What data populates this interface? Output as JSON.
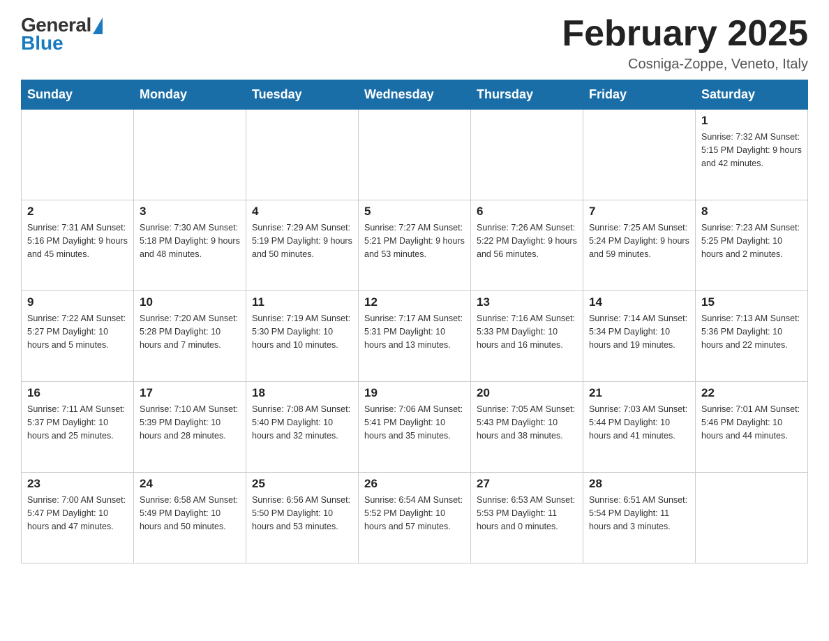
{
  "logo": {
    "general": "General",
    "blue": "Blue"
  },
  "title": "February 2025",
  "subtitle": "Cosniga-Zoppe, Veneto, Italy",
  "days_of_week": [
    "Sunday",
    "Monday",
    "Tuesday",
    "Wednesday",
    "Thursday",
    "Friday",
    "Saturday"
  ],
  "weeks": [
    [
      {
        "day": "",
        "info": ""
      },
      {
        "day": "",
        "info": ""
      },
      {
        "day": "",
        "info": ""
      },
      {
        "day": "",
        "info": ""
      },
      {
        "day": "",
        "info": ""
      },
      {
        "day": "",
        "info": ""
      },
      {
        "day": "1",
        "info": "Sunrise: 7:32 AM\nSunset: 5:15 PM\nDaylight: 9 hours\nand 42 minutes."
      }
    ],
    [
      {
        "day": "2",
        "info": "Sunrise: 7:31 AM\nSunset: 5:16 PM\nDaylight: 9 hours\nand 45 minutes."
      },
      {
        "day": "3",
        "info": "Sunrise: 7:30 AM\nSunset: 5:18 PM\nDaylight: 9 hours\nand 48 minutes."
      },
      {
        "day": "4",
        "info": "Sunrise: 7:29 AM\nSunset: 5:19 PM\nDaylight: 9 hours\nand 50 minutes."
      },
      {
        "day": "5",
        "info": "Sunrise: 7:27 AM\nSunset: 5:21 PM\nDaylight: 9 hours\nand 53 minutes."
      },
      {
        "day": "6",
        "info": "Sunrise: 7:26 AM\nSunset: 5:22 PM\nDaylight: 9 hours\nand 56 minutes."
      },
      {
        "day": "7",
        "info": "Sunrise: 7:25 AM\nSunset: 5:24 PM\nDaylight: 9 hours\nand 59 minutes."
      },
      {
        "day": "8",
        "info": "Sunrise: 7:23 AM\nSunset: 5:25 PM\nDaylight: 10 hours\nand 2 minutes."
      }
    ],
    [
      {
        "day": "9",
        "info": "Sunrise: 7:22 AM\nSunset: 5:27 PM\nDaylight: 10 hours\nand 5 minutes."
      },
      {
        "day": "10",
        "info": "Sunrise: 7:20 AM\nSunset: 5:28 PM\nDaylight: 10 hours\nand 7 minutes."
      },
      {
        "day": "11",
        "info": "Sunrise: 7:19 AM\nSunset: 5:30 PM\nDaylight: 10 hours\nand 10 minutes."
      },
      {
        "day": "12",
        "info": "Sunrise: 7:17 AM\nSunset: 5:31 PM\nDaylight: 10 hours\nand 13 minutes."
      },
      {
        "day": "13",
        "info": "Sunrise: 7:16 AM\nSunset: 5:33 PM\nDaylight: 10 hours\nand 16 minutes."
      },
      {
        "day": "14",
        "info": "Sunrise: 7:14 AM\nSunset: 5:34 PM\nDaylight: 10 hours\nand 19 minutes."
      },
      {
        "day": "15",
        "info": "Sunrise: 7:13 AM\nSunset: 5:36 PM\nDaylight: 10 hours\nand 22 minutes."
      }
    ],
    [
      {
        "day": "16",
        "info": "Sunrise: 7:11 AM\nSunset: 5:37 PM\nDaylight: 10 hours\nand 25 minutes."
      },
      {
        "day": "17",
        "info": "Sunrise: 7:10 AM\nSunset: 5:39 PM\nDaylight: 10 hours\nand 28 minutes."
      },
      {
        "day": "18",
        "info": "Sunrise: 7:08 AM\nSunset: 5:40 PM\nDaylight: 10 hours\nand 32 minutes."
      },
      {
        "day": "19",
        "info": "Sunrise: 7:06 AM\nSunset: 5:41 PM\nDaylight: 10 hours\nand 35 minutes."
      },
      {
        "day": "20",
        "info": "Sunrise: 7:05 AM\nSunset: 5:43 PM\nDaylight: 10 hours\nand 38 minutes."
      },
      {
        "day": "21",
        "info": "Sunrise: 7:03 AM\nSunset: 5:44 PM\nDaylight: 10 hours\nand 41 minutes."
      },
      {
        "day": "22",
        "info": "Sunrise: 7:01 AM\nSunset: 5:46 PM\nDaylight: 10 hours\nand 44 minutes."
      }
    ],
    [
      {
        "day": "23",
        "info": "Sunrise: 7:00 AM\nSunset: 5:47 PM\nDaylight: 10 hours\nand 47 minutes."
      },
      {
        "day": "24",
        "info": "Sunrise: 6:58 AM\nSunset: 5:49 PM\nDaylight: 10 hours\nand 50 minutes."
      },
      {
        "day": "25",
        "info": "Sunrise: 6:56 AM\nSunset: 5:50 PM\nDaylight: 10 hours\nand 53 minutes."
      },
      {
        "day": "26",
        "info": "Sunrise: 6:54 AM\nSunset: 5:52 PM\nDaylight: 10 hours\nand 57 minutes."
      },
      {
        "day": "27",
        "info": "Sunrise: 6:53 AM\nSunset: 5:53 PM\nDaylight: 11 hours\nand 0 minutes."
      },
      {
        "day": "28",
        "info": "Sunrise: 6:51 AM\nSunset: 5:54 PM\nDaylight: 11 hours\nand 3 minutes."
      },
      {
        "day": "",
        "info": ""
      }
    ]
  ]
}
